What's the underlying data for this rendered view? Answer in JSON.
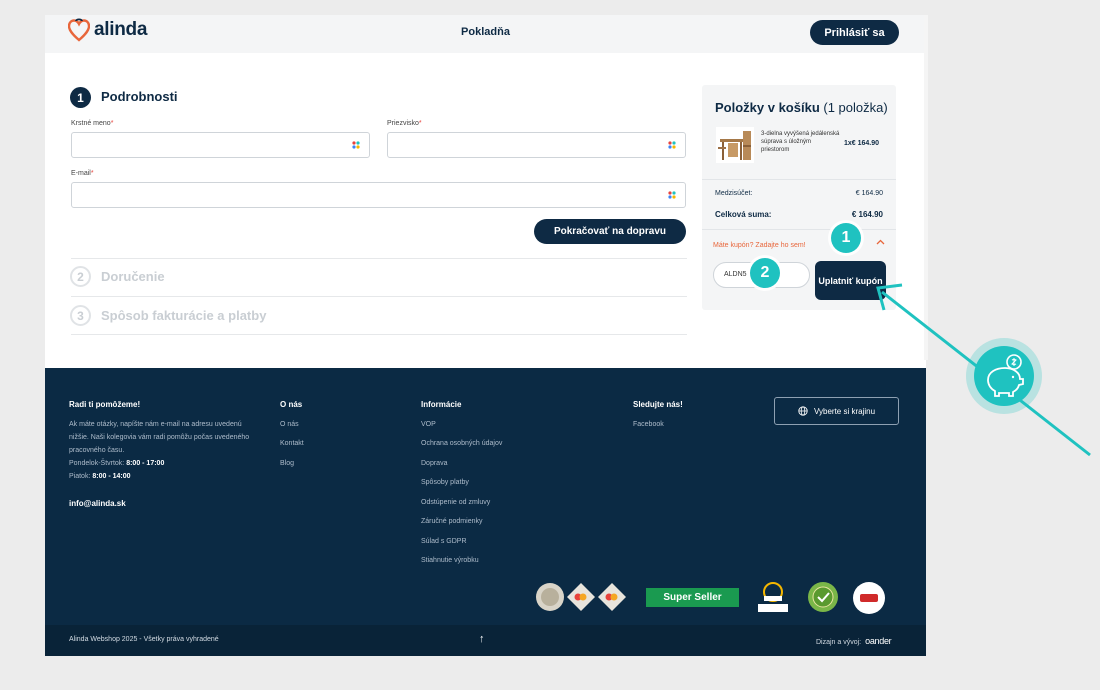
{
  "header": {
    "brand": "alinda",
    "title": "Pokladňa",
    "login_label": "Prihlásiť sa"
  },
  "form": {
    "step1": {
      "number": "1",
      "title": "Podrobnosti"
    },
    "first_name_label": "Krstné meno",
    "last_name_label": "Priezvisko",
    "email_label": "E-mail",
    "required_mark": "*",
    "first_name_value": "",
    "last_name_value": "",
    "email_value": "",
    "continue_label": "Pokračovať na dopravu",
    "step2": {
      "number": "2",
      "title": "Doručenie"
    },
    "step3": {
      "number": "3",
      "title": "Spôsob fakturácie a platby"
    }
  },
  "cart": {
    "title": "Položky v košíku",
    "count": "(1 položka)",
    "product_name": "3-dielna vyvýšená jedálenská súprava s úložným priestorom",
    "product_price": "1x€ 164.90",
    "subtotal_label": "Medzisúčet:",
    "subtotal_value": "€ 164.90",
    "total_label": "Celková suma:",
    "total_value": "€ 164.90",
    "coupon_toggle": "Máte kupón? Zadajte ho sem!",
    "coupon_value": "ALDN5",
    "apply_label": "Uplatniť kupón"
  },
  "markers": {
    "m1": "1",
    "m2": "2"
  },
  "footer": {
    "col1": {
      "heading": "Radi ti pomôžeme!",
      "text": "Ak máte otázky, napíšte nám e-mail na adresu uvedenú nižšie. Naši kolegovia vám radi pomôžu počas uvedeného pracovného času.",
      "hours1_label": "Pondelok-Štvrtok:",
      "hours1_value": "8:00 - 17:00",
      "hours2_label": "Piatok:",
      "hours2_value": "8:00 - 14:00",
      "email": "info@alinda.sk"
    },
    "col2": {
      "heading": "O nás",
      "links": [
        "O nás",
        "Kontakt",
        "Blog"
      ]
    },
    "col3": {
      "heading": "Informácie",
      "links": [
        "VOP",
        "Ochrana osobných údajov",
        "Doprava",
        "Spôsoby platby",
        "Odstúpenie od zmluvy",
        "Záručné podmienky",
        "Súlad s GDPR",
        "Stiahnutie výrobku"
      ]
    },
    "col4": {
      "heading": "Sledujte nás!",
      "links": [
        "Facebook"
      ]
    },
    "country_button": "Vyberte si krajinu",
    "super_seller": "Super Seller",
    "copyright": "Alinda Webshop 2025 - Všetky práva vyhradené",
    "back_to_top": "↑",
    "design_label": "Dizajn a vývoj:",
    "agency": "oander"
  },
  "colors": {
    "navy": "#0e2a44",
    "teal_marker": "#1fc2c0",
    "coupon_orange": "#e8663b",
    "required_red": "#e8423b"
  },
  "icons": [
    "alinda-heart-logo",
    "password-manager-icon",
    "globe-icon",
    "piggy-bank-coin-icon",
    "chevron-up-icon",
    "arrow-up-icon"
  ]
}
